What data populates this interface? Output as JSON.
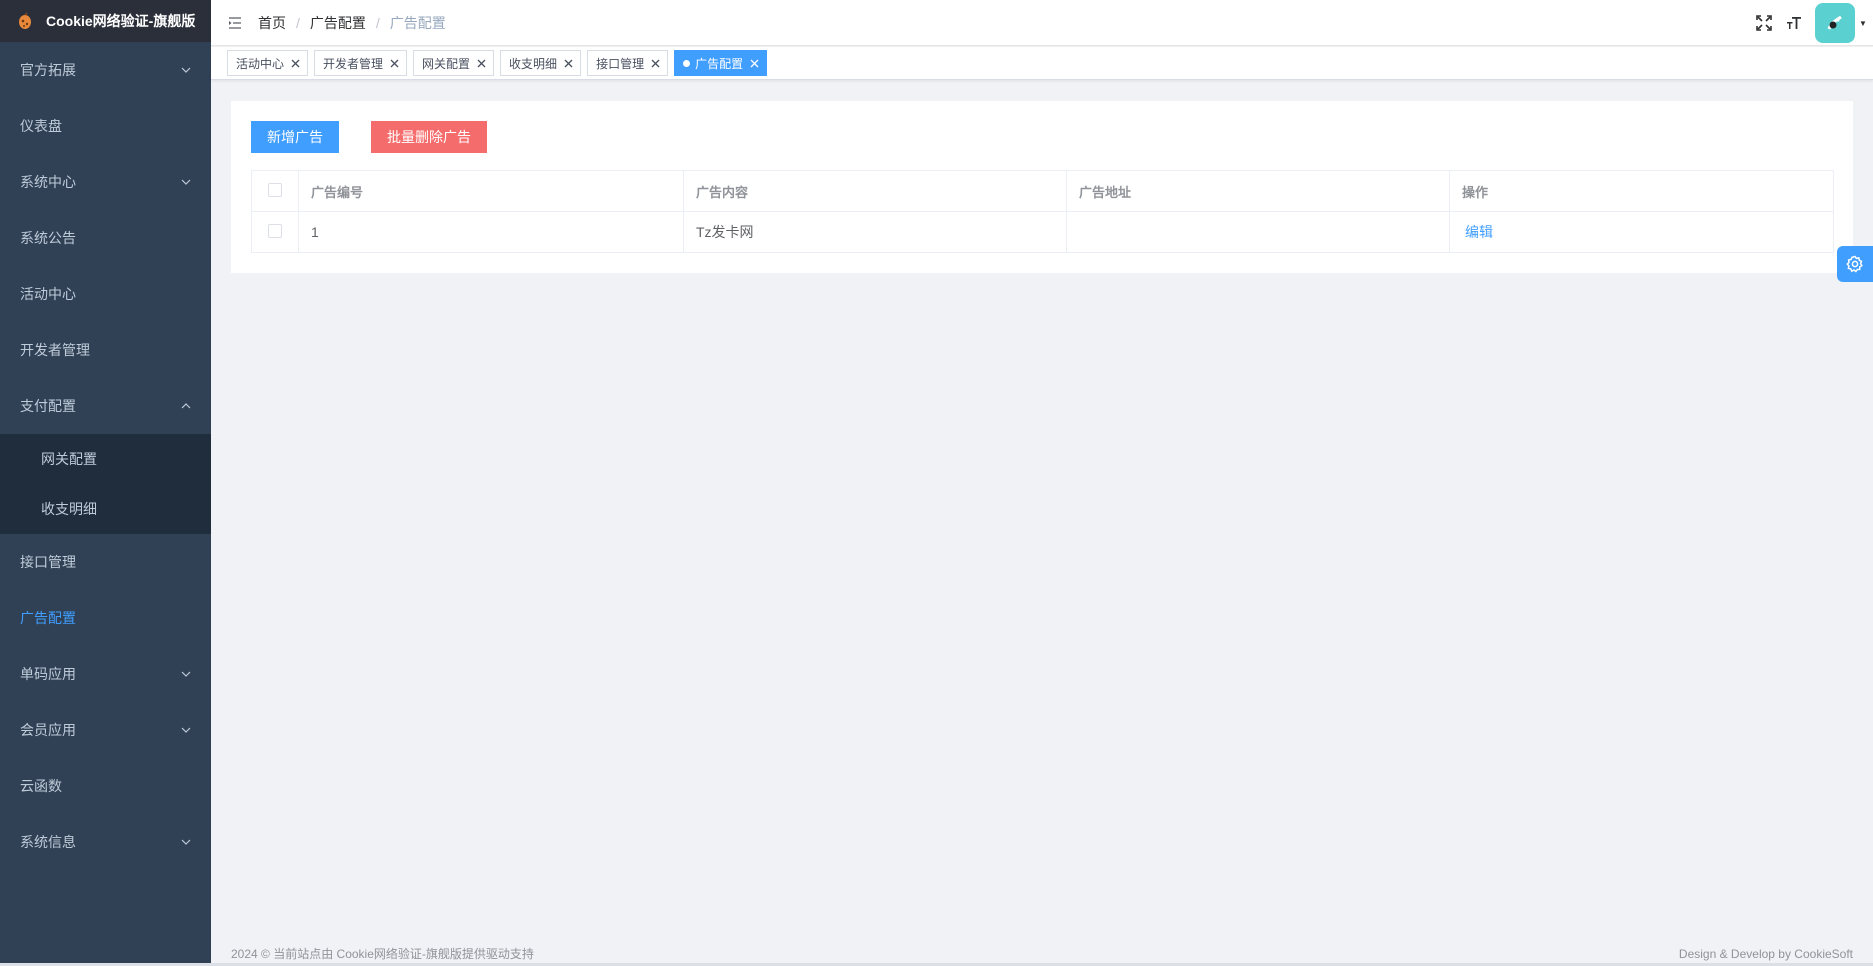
{
  "app": {
    "title": "Cookie网络验证-旗舰版"
  },
  "sidebar": {
    "items": [
      {
        "label": "官方拓展",
        "has_arrow": true
      },
      {
        "label": "仪表盘"
      },
      {
        "label": "系统中心",
        "has_arrow": true
      },
      {
        "label": "系统公告"
      },
      {
        "label": "活动中心"
      },
      {
        "label": "开发者管理"
      },
      {
        "label": "支付配置",
        "expanded": true
      },
      {
        "label": "接口管理"
      },
      {
        "label": "广告配置",
        "active": true
      },
      {
        "label": "单码应用",
        "has_arrow": true
      },
      {
        "label": "会员应用",
        "has_arrow": true
      },
      {
        "label": "云函数"
      },
      {
        "label": "系统信息",
        "has_arrow": true
      }
    ],
    "submenu": [
      {
        "label": "网关配置"
      },
      {
        "label": "收支明细"
      }
    ]
  },
  "breadcrumb": [
    "首页",
    "广告配置",
    "广告配置"
  ],
  "tags": [
    {
      "label": "活动中心"
    },
    {
      "label": "开发者管理"
    },
    {
      "label": "网关配置"
    },
    {
      "label": "收支明细"
    },
    {
      "label": "接口管理"
    },
    {
      "label": "广告配置",
      "active": true
    }
  ],
  "toolbar": {
    "add_label": "新增广告",
    "batch_delete_label": "批量删除广告"
  },
  "table": {
    "headers": [
      "广告编号",
      "广告内容",
      "广告地址",
      "操作"
    ],
    "rows": [
      {
        "id": "1",
        "content": "Tz发卡网",
        "url": "",
        "action": "编辑"
      }
    ]
  },
  "footer": {
    "left": "2024 © 当前站点由 Cookie网络验证-旗舰版提供驱动支持",
    "right": "Design & Develop by CookieSoft"
  },
  "colors": {
    "sidebar_bg": "#304156",
    "logo_bg": "#2b2f3a",
    "submenu_bg": "#1f2d3d",
    "primary": "#409eff",
    "danger": "#f56c6c"
  }
}
